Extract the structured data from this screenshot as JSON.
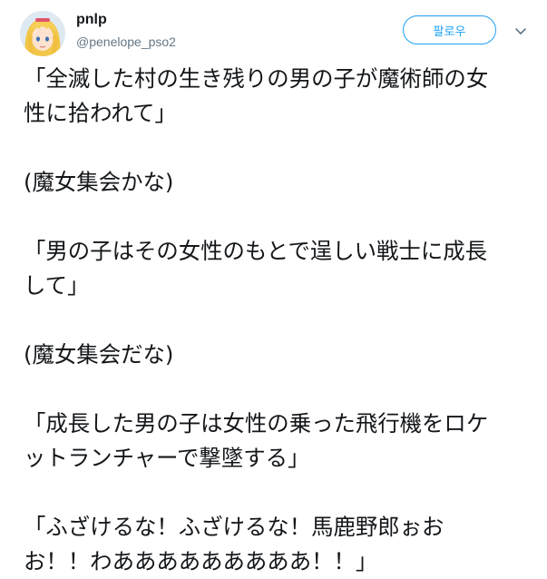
{
  "tweet": {
    "author": {
      "name": "pnlp",
      "handle": "@penelope_pso2",
      "avatar_icon": "anime-girl-avatar"
    },
    "follow_label": "팔로우",
    "menu_icon": "chevron-down-icon",
    "paragraphs": [
      [
        "「全滅した村の生き残りの男の子が魔術師の女",
        "性に拾われて」"
      ],
      [
        "(魔女集会かな)"
      ],
      [
        "「男の子はその女性のもとで逞しい戦士に成長",
        "して」"
      ],
      [
        "(魔女集会だな)"
      ],
      [
        "「成長した男の子は女性の乗った飛行機をロケ",
        "ットランチャーで撃墜する」"
      ],
      [
        "「ふざけるな！ふざけるな！馬鹿野郎ぉお",
        "お！！わあああああああああ！！」"
      ]
    ]
  },
  "colors": {
    "accent": "#1da1f2",
    "text": "#14171a",
    "secondary": "#657786"
  }
}
